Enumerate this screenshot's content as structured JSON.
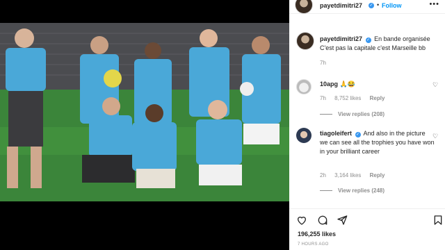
{
  "post": {
    "username": "payetdimitri27",
    "follow_label": "Follow",
    "more_label": "•••",
    "dot": "•"
  },
  "caption": {
    "username": "payetdimitri27",
    "text": "En bande organisée C'est pas la capitale c'est Marseille bb",
    "time": "7h"
  },
  "comments": [
    {
      "username": "10apg",
      "text": "🙏😂",
      "time": "7h",
      "likes": "8,752 likes",
      "reply_label": "Reply",
      "view_replies": "View replies (208)"
    },
    {
      "username": "tiagoleifert",
      "text": "And also in the picture we can see all the trophies you have won in your brilliant career",
      "time": "2h",
      "likes": "3,164 likes",
      "reply_label": "Reply",
      "view_replies": "View replies (248)"
    }
  ],
  "footer": {
    "likes": "196,255 likes",
    "posted": "7 HOURS AGO"
  },
  "colors": {
    "accent": "#0095f6",
    "verified": "#3897f0",
    "jersey": "#4aa8d8"
  },
  "icons": [
    "heart-icon",
    "comment-icon",
    "share-icon",
    "bookmark-icon",
    "verified-icon",
    "more-icon"
  ]
}
